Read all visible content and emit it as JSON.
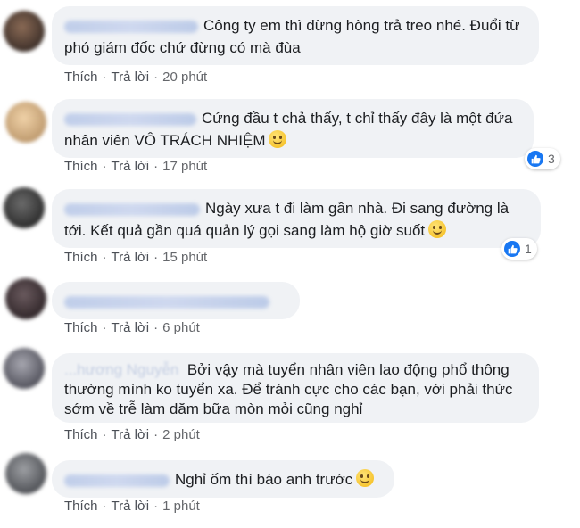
{
  "actions": {
    "like_label": "Thích",
    "reply_label": "Trả lời",
    "separator": "·"
  },
  "comments": [
    {
      "text": "Công ty em thì đừng hòng trả treo nhé. Đuổi từ phó giám đốc chứ đừng có mà đùa",
      "time": "20 phút"
    },
    {
      "text": "Cứng đầu t chả thấy, t chỉ thấy đây là một đứa nhân viên VÔ TRÁCH NHIỆM",
      "time": "17 phút",
      "reactions": "3"
    },
    {
      "text": "Ngày xưa t đi làm gần nhà. Đi sang đường là tới. Kết quả gần quá quản lý gọi sang làm hộ giờ suốt",
      "time": "15 phút",
      "reactions": "1"
    },
    {
      "text": "",
      "time": "6 phút"
    },
    {
      "author": "...hương Nguyễn",
      "text": "Bởi vậy mà tuyển nhân viên lao động phổ thông thường mình ko tuyển xa. Để tránh cực cho các bạn, với phải thức sớm về trễ làm dăm bữa mòn mỏi cũng nghỉ",
      "time": "2 phút"
    },
    {
      "text": "Nghỉ ốm thì báo anh trước",
      "time": "1 phút"
    }
  ]
}
